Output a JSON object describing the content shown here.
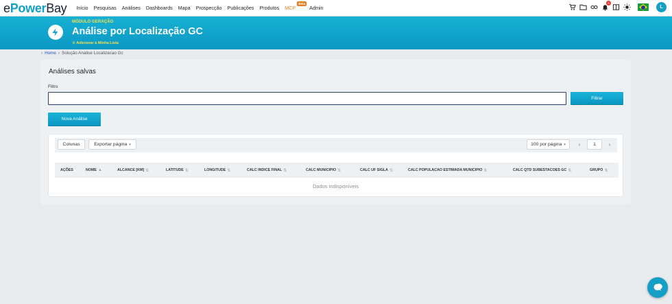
{
  "brand": {
    "prefix": "e",
    "power": "Power",
    "suffix": "Bay"
  },
  "nav": [
    {
      "label": "Início"
    },
    {
      "label": "Pesquisas"
    },
    {
      "label": "Análises"
    },
    {
      "label": "Dashboards"
    },
    {
      "label": "Mapa"
    },
    {
      "label": "Prospecção"
    },
    {
      "label": "Publicações"
    },
    {
      "label": "Produtos"
    },
    {
      "label": "MCP",
      "badge": "Beta"
    },
    {
      "label": "Admin"
    }
  ],
  "topbar": {
    "notifications_count": "4",
    "avatar_initial": "L"
  },
  "banner": {
    "module": "MÓDULO GERAÇÃO",
    "title": "Análise por Localização GC",
    "add_to_list": "☆ Adicionar à Minha Lista"
  },
  "breadcrumb": {
    "home": "Home",
    "current": "Solução Analise Localizacao Gc"
  },
  "card": {
    "title": "Análises salvas",
    "filter_label": "Filtro",
    "filter_value": "",
    "filter_button": "Filtrar",
    "new_button": "Nova Análise"
  },
  "table": {
    "columns_button": "Colunas",
    "export_button": "Exportar página",
    "per_page": "100 por página",
    "page": "1",
    "headers": [
      "AÇÕES",
      "NOME",
      "ALCANCE [KM]",
      "LATITUDE",
      "LONGITUDE",
      "CALC INDICE FINAL",
      "CALC MUNICIPIO",
      "CALC UF SIGLA",
      "CALC POPULACAO ESTIMADA MUNICIPIO",
      "CALC QTD SUBESTACOES GC",
      "GRUPO"
    ],
    "empty_text": "Dados indisponíveis"
  },
  "colors": {
    "accent": "#159fc7",
    "banner_text": "#f7e04b",
    "mcp": "#e67e22"
  }
}
